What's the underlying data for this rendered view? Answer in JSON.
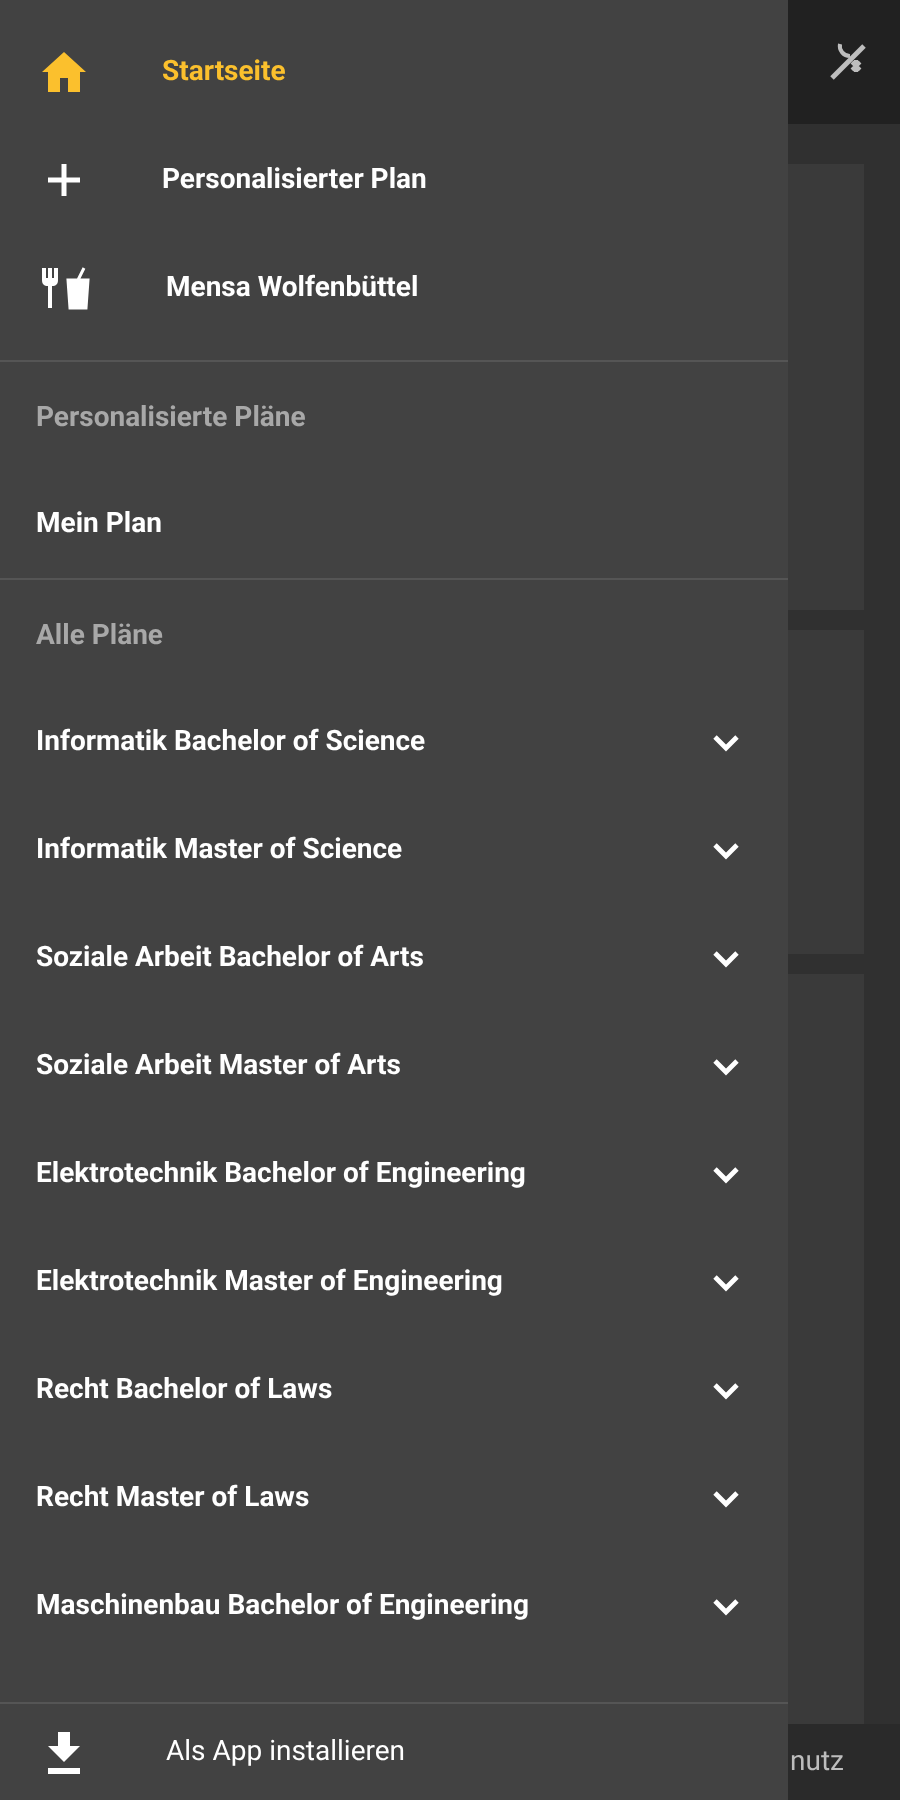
{
  "drawer": {
    "nav_items": [
      {
        "kind": "home",
        "label": "Startseite",
        "selected": true
      },
      {
        "kind": "create",
        "label": "Personalisierter Plan",
        "selected": false
      },
      {
        "kind": "canteen",
        "label": "Mensa Wolfenbüttel",
        "selected": false
      }
    ],
    "personal_section": {
      "title": "Personalisierte Pläne",
      "items": [
        {
          "label": "Mein Plan",
          "selected": false
        }
      ]
    },
    "all_section": {
      "title": "Alle Pläne",
      "items": [
        {
          "label": "Informatik Bachelor of Science",
          "expanded": false
        },
        {
          "label": "Informatik Master of Science",
          "expanded": false
        },
        {
          "label": "Soziale Arbeit Bachelor of Arts",
          "expanded": false
        },
        {
          "label": "Soziale Arbeit Master of Arts",
          "expanded": false
        },
        {
          "label": "Elektrotechnik Bachelor of Engineering",
          "expanded": false
        },
        {
          "label": "Elektrotechnik Master of Engineering",
          "expanded": false
        },
        {
          "label": "Recht Bachelor of Laws",
          "expanded": false
        },
        {
          "label": "Recht Master of Laws",
          "expanded": false
        },
        {
          "label": "Maschinenbau Bachelor of Engineering",
          "expanded": false
        }
      ]
    },
    "install": {
      "label": "Als App installieren"
    }
  },
  "footer": {
    "text": "nutz"
  }
}
